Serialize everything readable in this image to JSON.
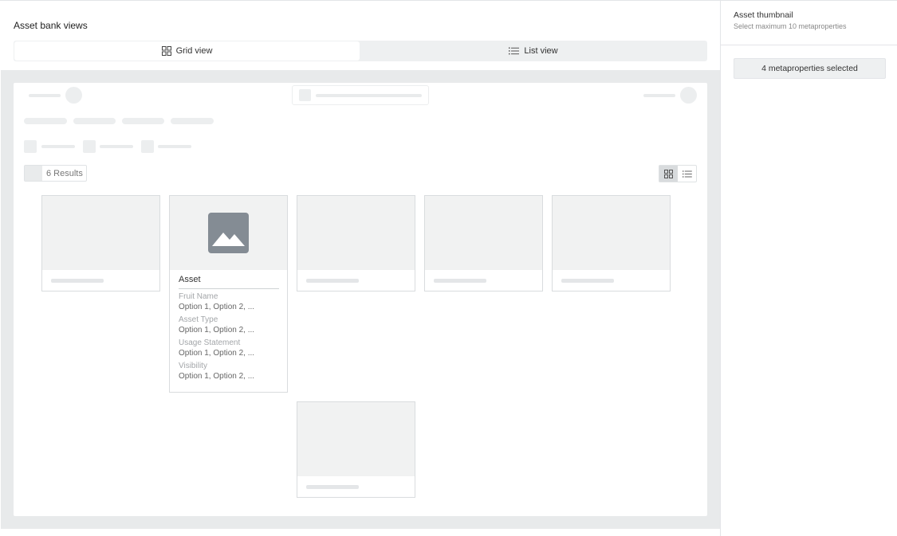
{
  "main": {
    "section_title": "Asset bank views",
    "tabs": [
      {
        "label": "Grid view",
        "icon": "grid-icon",
        "active": true
      },
      {
        "label": "List view",
        "icon": "list-icon",
        "active": false
      }
    ]
  },
  "preview": {
    "results_label": "6 Results",
    "layout_modes": [
      "grid-icon",
      "list-icon"
    ],
    "asset_card": {
      "title": "Asset",
      "thumbnail_icon": "image-placeholder-icon",
      "fields": [
        {
          "label": "Fruit Name",
          "value": "Option 1, Option 2, ..."
        },
        {
          "label": "Asset Type",
          "value": "Option 1, Option 2, ..."
        },
        {
          "label": "Usage Statement",
          "value": "Option 1, Option 2, ..."
        },
        {
          "label": "Visibility",
          "value": "Option 1, Option 2, ..."
        }
      ]
    }
  },
  "sidebar": {
    "title": "Asset thumbnail",
    "subtitle": "Select maximum 10 metaproperties",
    "metaproperties_button": "4 metaproperties selected"
  },
  "colors": {
    "placeholder": "#eceeef",
    "preview_background": "#e8eaeb",
    "image_icon": "#848c94"
  }
}
